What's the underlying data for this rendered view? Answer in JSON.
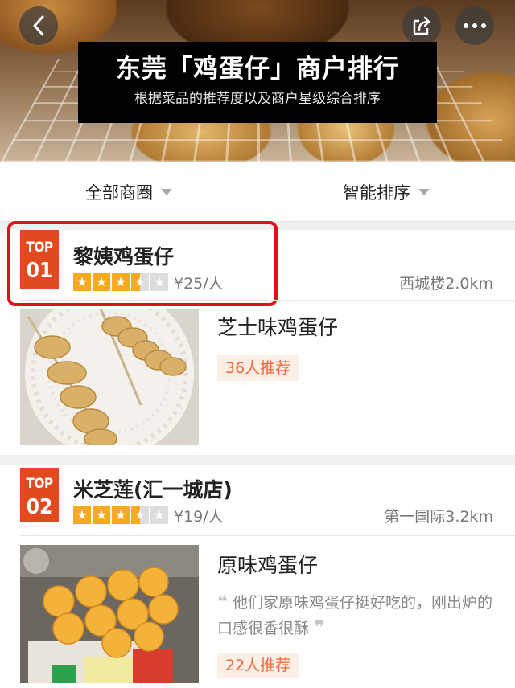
{
  "banner": {
    "title": "东莞「鸡蛋仔」商户排行",
    "subtitle": "根据菜品的推荐度以及商户星级综合排序"
  },
  "filters": {
    "area": "全部商圈",
    "sort": "智能排序"
  },
  "shops": [
    {
      "badge_label": "TOP",
      "badge_rank": "01",
      "name": "黎姨鸡蛋仔",
      "rating": 3.5,
      "price": "¥25/人",
      "distance": "西城楼2.0km",
      "dish": {
        "name": "芝士味鸡蛋仔",
        "recommend": "36人推荐"
      }
    },
    {
      "badge_label": "TOP",
      "badge_rank": "02",
      "name": "米芝莲(汇一城店)",
      "rating": 3.5,
      "price": "¥19/人",
      "distance": "第一国际3.2km",
      "dish": {
        "name": "原味鸡蛋仔",
        "review_open": "❝",
        "review": "他们家原味鸡蛋仔挺好吃的，刚出炉的口感很香很酥",
        "review_close": "❞",
        "recommend": "22人推荐"
      }
    }
  ],
  "colors": {
    "badge": "#e04a1e",
    "star": "#f7a920",
    "recommend_text": "#f0693a",
    "recommend_bg": "#fdeee6",
    "highlight": "#e3101b"
  }
}
